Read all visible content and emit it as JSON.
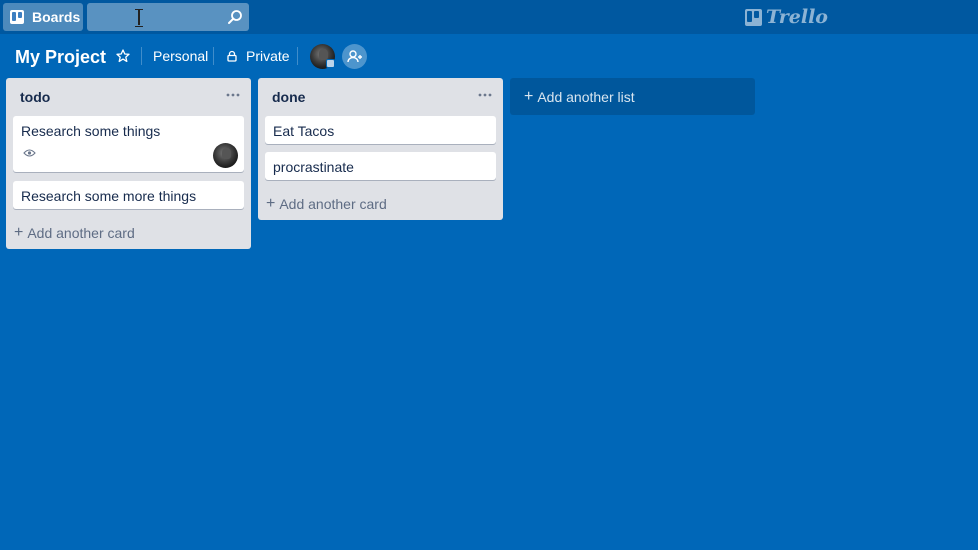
{
  "topbar": {
    "boards_label": "Boards",
    "search_value": "",
    "logo_text": "Trello"
  },
  "board": {
    "title": "My Project",
    "team": "Personal",
    "visibility": "Private"
  },
  "lists": [
    {
      "title": "todo",
      "cards": [
        {
          "title": "Research some things",
          "watching": true,
          "has_member": true
        },
        {
          "title": "Research some more things"
        }
      ],
      "add_card_label": "Add another card"
    },
    {
      "title": "done",
      "cards": [
        {
          "title": "Eat Tacos"
        },
        {
          "title": "procrastinate"
        }
      ],
      "add_card_label": "Add another card"
    }
  ],
  "add_list_label": "Add another list",
  "colors": {
    "board_background": "#0067b8",
    "topbar": "#0058a0",
    "list_background": "#dfe1e6"
  }
}
